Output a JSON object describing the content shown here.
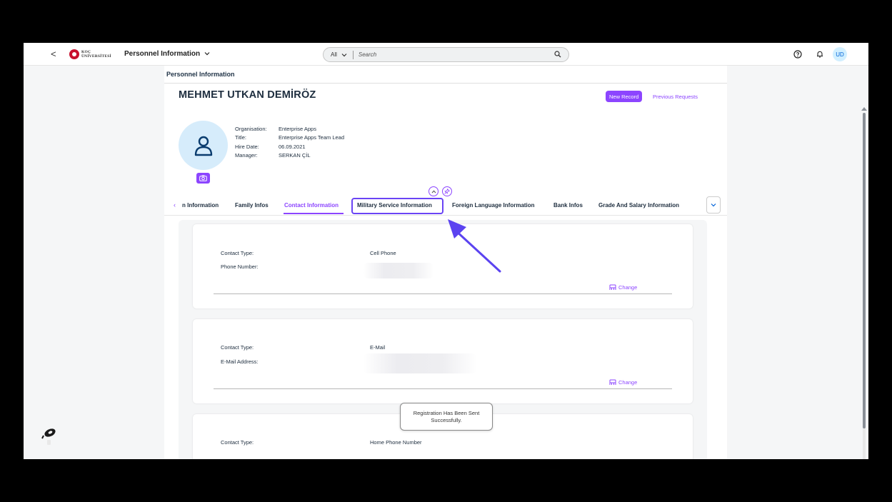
{
  "shell": {
    "back_glyph": "<",
    "logo_line1": "KOÇ",
    "logo_line2": "ÜNİVERSİTESİ",
    "app_title": "Personnel Information",
    "search_scope": "All",
    "search_placeholder": "Search",
    "user_initials": "UD"
  },
  "page": {
    "breadcrumb": "Personnel Information",
    "employee_name": "MEHMET UTKAN DEMİRÖZ",
    "new_record_label": "New Record",
    "previous_requests_label": "Previous Requests",
    "info": [
      {
        "label": "Organisation:",
        "value": "Enterprise Apps"
      },
      {
        "label": "Title:",
        "value": "Enterprise Apps Team Lead"
      },
      {
        "label": "Hire Date:",
        "value": "06.09.2021"
      },
      {
        "label": "Manager:",
        "value": "SERKAN ÇİL"
      }
    ]
  },
  "tabs": [
    {
      "label": "n Information",
      "active": false
    },
    {
      "label": "Family Infos",
      "active": false
    },
    {
      "label": "Contact Information",
      "active": true
    },
    {
      "label": "Military Service Information",
      "active": false
    },
    {
      "label": "Foreign Language Information",
      "active": false
    },
    {
      "label": "Bank Infos",
      "active": false
    },
    {
      "label": "Grade And Salary Information",
      "active": false
    }
  ],
  "cards": [
    {
      "type_label": "Contact Type:",
      "type_value": "Cell Phone",
      "second_label": "Phone Number:",
      "change_label": "Change"
    },
    {
      "type_label": "Contact Type:",
      "type_value": "E-Mail",
      "second_label": "E-Mail Address:",
      "change_label": "Change"
    },
    {
      "type_label": "Contact Type:",
      "type_value": "Home Phone Number"
    }
  ],
  "toast": "Registration Has Been Sent Successfully.",
  "colors": {
    "accent": "#8c45ff",
    "highlight": "#6a44f5",
    "brand_red": "#c8102e"
  }
}
